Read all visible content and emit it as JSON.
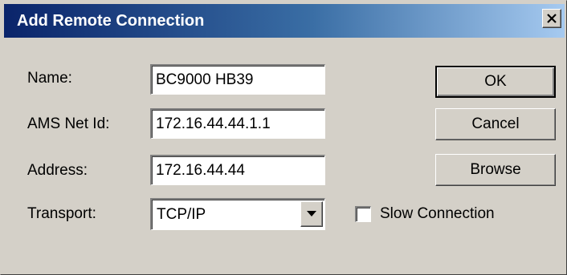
{
  "window": {
    "title": "Add Remote Connection",
    "close_glyph": "close-icon"
  },
  "form": {
    "name_label": "Name:",
    "name_value": "BC9000 HB39",
    "ams_label": "AMS Net Id:",
    "ams_value": "172.16.44.44.1.1",
    "address_label": "Address:",
    "address_value": "172.16.44.44",
    "transport_label": "Transport:",
    "transport_value": "TCP/IP",
    "transport_arrow_icon": "chevron-down-icon",
    "slow_connection_label": "Slow Connection",
    "slow_connection_checked": false
  },
  "buttons": {
    "ok_label": "OK",
    "cancel_label": "Cancel",
    "browse_label": "Browse"
  },
  "colors": {
    "titlebar_start": "#0a246a",
    "titlebar_end": "#a6caf0",
    "face": "#d4d0c8"
  }
}
